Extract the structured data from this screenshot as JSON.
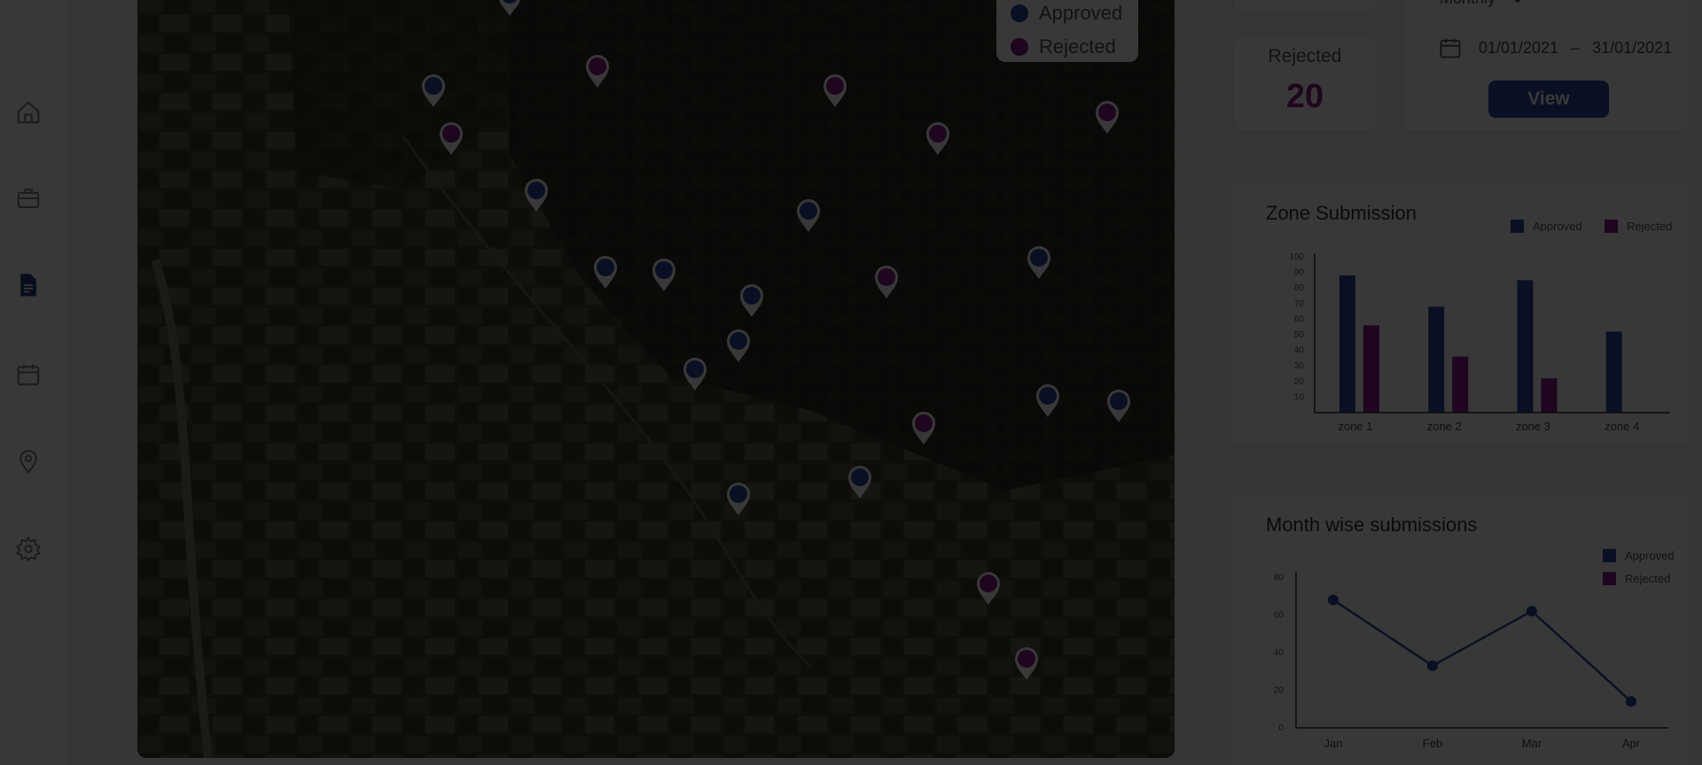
{
  "colors": {
    "approved": "#2f4a9e",
    "rejected": "#8a1f8f",
    "overlay": "rgba(0,0,0,0.78)"
  },
  "sidebar": {
    "items": [
      {
        "icon": "home-icon",
        "active": false
      },
      {
        "icon": "briefcase-icon",
        "active": false
      },
      {
        "icon": "document-icon",
        "active": true
      },
      {
        "icon": "calendar-icon",
        "active": false
      },
      {
        "icon": "location-pin-icon",
        "active": false
      },
      {
        "icon": "gear-icon",
        "active": false
      }
    ]
  },
  "map": {
    "legend": {
      "approved": "Approved",
      "rejected": "Rejected"
    },
    "markers": [
      {
        "status": "approved"
      },
      {
        "status": "rejected"
      },
      {
        "status": "approved"
      },
      {
        "status": "rejected"
      },
      {
        "status": "rejected"
      },
      {
        "status": "rejected"
      },
      {
        "status": "rejected"
      },
      {
        "status": "approved"
      },
      {
        "status": "approved"
      },
      {
        "status": "approved"
      },
      {
        "status": "approved"
      },
      {
        "status": "approved"
      },
      {
        "status": "rejected"
      },
      {
        "status": "approved"
      },
      {
        "status": "approved"
      },
      {
        "status": "approved"
      },
      {
        "status": "approved"
      },
      {
        "status": "rejected"
      },
      {
        "status": "approved"
      },
      {
        "status": "approved"
      },
      {
        "status": "approved"
      },
      {
        "status": "rejected"
      },
      {
        "status": "rejected"
      }
    ]
  },
  "stats": {
    "rejected_label": "Rejected",
    "rejected_value": "20"
  },
  "filter": {
    "period": "Monthly",
    "date_from": "01/01/2021",
    "date_sep": "–",
    "date_to": "31/01/2021",
    "view_label": "View"
  },
  "zone_chart": {
    "title": "Zone Submission",
    "legend": {
      "approved": "Approved",
      "rejected": "Rejected"
    }
  },
  "month_chart": {
    "title": "Month wise submissions",
    "legend": {
      "approved": "Approved",
      "rejected": "Rejected"
    }
  },
  "chart_data": [
    {
      "type": "bar",
      "title": "Zone Submission",
      "categories": [
        "zone 1",
        "zone 2",
        "zone 3",
        "zone 4"
      ],
      "series": [
        {
          "name": "Approved",
          "values": [
            88,
            68,
            85,
            52
          ]
        },
        {
          "name": "Rejected",
          "values": [
            56,
            36,
            22,
            null
          ]
        }
      ],
      "ylim": [
        0,
        100
      ],
      "yticks": [
        10,
        20,
        30,
        40,
        50,
        60,
        70,
        80,
        90,
        100
      ],
      "legend_position": "top-right"
    },
    {
      "type": "line",
      "title": "Month wise submissions",
      "categories": [
        "Jan",
        "Feb",
        "Mar",
        "Apr"
      ],
      "series": [
        {
          "name": "Approved",
          "values": [
            68,
            33,
            62,
            14
          ]
        }
      ],
      "legend_entries": [
        "Approved",
        "Rejected"
      ],
      "ylim": [
        0,
        80
      ],
      "yticks": [
        0,
        20,
        40,
        60,
        80
      ],
      "legend_position": "top-right"
    }
  ]
}
